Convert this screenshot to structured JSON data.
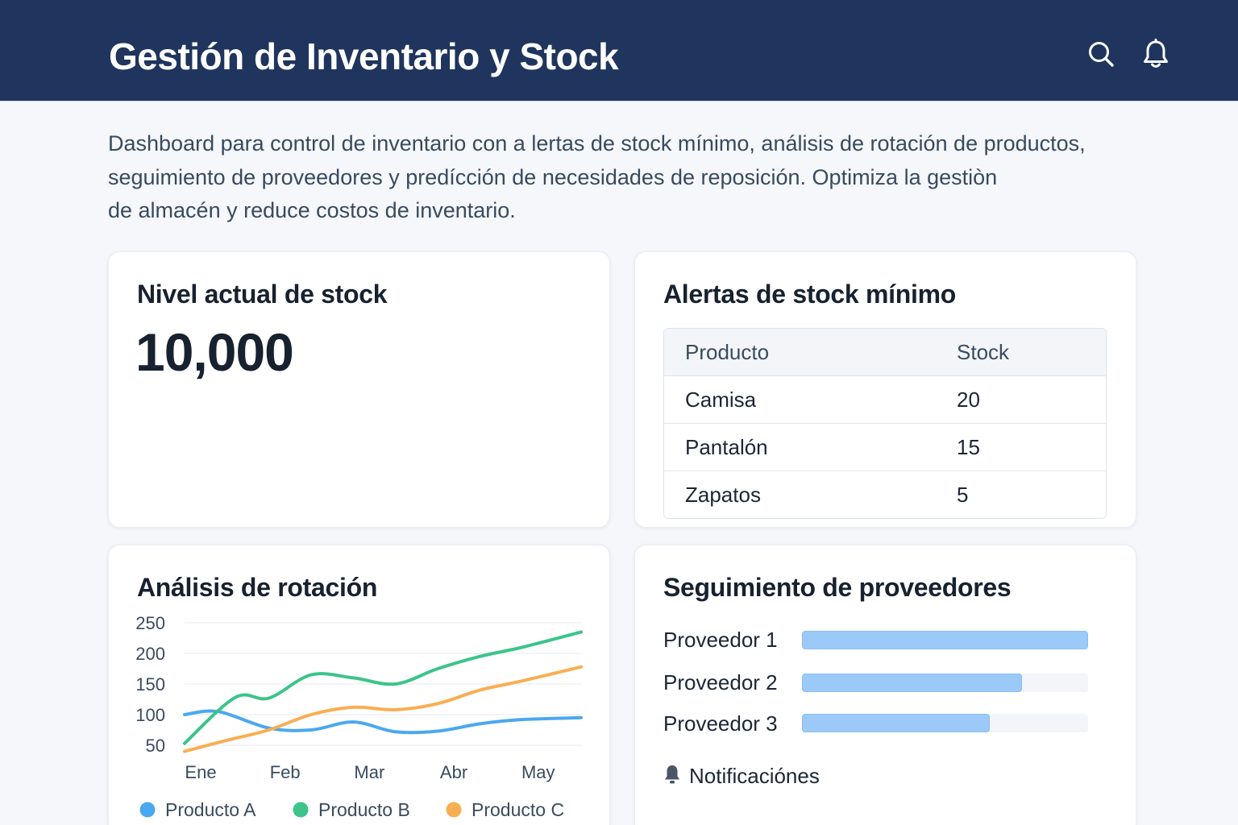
{
  "header": {
    "title": "Gestión de Inventario y Stock",
    "icons": [
      "search-icon",
      "bell-icon"
    ],
    "background": "#1f355d"
  },
  "description": "Dashboard para control de inventario con a lertas de stock mínimo, análisis de rotación de productos,\nseguimiento de proveedores y predícción de necesidades de reposición. Optimiza la gestiòn\nde almacén y reduce costos de inventario.",
  "stock_card": {
    "title": "Nivel actual de stock",
    "value": "10,000"
  },
  "alerts_card": {
    "title": "Alertas de stock mínimo",
    "columns": [
      "Producto",
      "Stock"
    ],
    "rows": [
      [
        "Camisa",
        "20"
      ],
      [
        "Pantalón",
        "15"
      ],
      [
        "Zapatos",
        "5"
      ]
    ]
  },
  "rotation_card": {
    "title": "Análisis de rotación"
  },
  "chart_data": {
    "type": "line",
    "title": "Análisis de rotación",
    "categories": [
      "Ene",
      "Feb",
      "Mar",
      "Abr",
      "May"
    ],
    "ylim": [
      50,
      250
    ],
    "yticks": [
      250,
      200,
      150,
      100,
      50
    ],
    "grid": true,
    "legend": "bottom",
    "series": [
      {
        "name": "Producto A",
        "color": "#4aa8f0",
        "x": [
          0,
          0.4,
          1,
          1.5,
          2,
          2.5,
          3,
          3.5,
          4,
          4.7
        ],
        "values": [
          100,
          105,
          78,
          75,
          88,
          72,
          73,
          85,
          92,
          95
        ]
      },
      {
        "name": "Producto B",
        "color": "#3cc48a",
        "x": [
          0,
          0.6,
          1,
          1.5,
          2,
          2.5,
          3,
          3.5,
          4,
          4.7
        ],
        "values": [
          53,
          128,
          127,
          165,
          160,
          150,
          175,
          195,
          210,
          235
        ]
      },
      {
        "name": "Producto C",
        "color": "#f9ae52",
        "x": [
          0,
          0.5,
          1,
          1.5,
          2,
          2.5,
          3,
          3.5,
          4,
          4.7
        ],
        "values": [
          40,
          58,
          75,
          100,
          112,
          108,
          118,
          140,
          155,
          178
        ]
      }
    ]
  },
  "suppliers_card": {
    "title": "Seguimiento de proveedores",
    "bar_color": "#9ccaf8",
    "suppliers": [
      {
        "name": "Proveedor 1",
        "level": 1.0
      },
      {
        "name": "Proveedor 2",
        "level": 0.77
      },
      {
        "name": "Proveedor 3",
        "level": 0.655
      }
    ],
    "notifications_label": "Notificaciónes",
    "notifications_icon": "bell-icon"
  }
}
